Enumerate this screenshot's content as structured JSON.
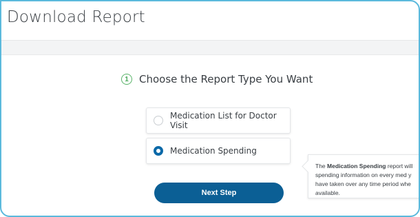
{
  "page": {
    "title": "Download Report"
  },
  "step": {
    "number": "1",
    "title": "Choose the Report Type You Want"
  },
  "options": [
    {
      "label": "Medication List for Doctor Visit",
      "selected": false
    },
    {
      "label": "Medication Spending",
      "selected": true
    }
  ],
  "tooltip": {
    "prefix": "The ",
    "bold": "Medication Spending",
    "line1_suffix": " report will",
    "line2": "spending information on every med y",
    "line3": "have taken over any time period whe",
    "line4": "available."
  },
  "next_button": {
    "label": "Next Step"
  },
  "colors": {
    "frame_border": "#5bb9dc",
    "step_green": "#58b368",
    "primary_blue": "#0b5f95",
    "radio_selected": "#0b69a8"
  }
}
